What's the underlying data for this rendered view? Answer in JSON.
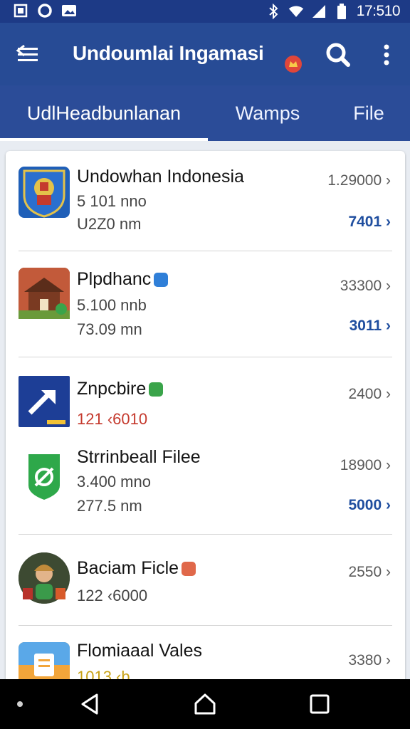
{
  "status_bar": {
    "time": "17:510",
    "left_icons": [
      "sim-icon",
      "circle-icon",
      "image-icon"
    ],
    "right_icons": [
      "bluetooth-icon",
      "wifi-icon",
      "signal-icon",
      "battery-icon"
    ]
  },
  "app_bar": {
    "title": "Undoumlai Ingamasi",
    "icons": [
      "menu-icon",
      "search-icon",
      "more-vert-icon"
    ]
  },
  "tabs": [
    {
      "label": "UdlHeadbunlanan",
      "selected": true
    },
    {
      "label": "Wamps",
      "selected": false
    },
    {
      "label": "File",
      "selected": false
    }
  ],
  "items": [
    {
      "title": "Undowhan Indonesia",
      "line2": "5 101 nno",
      "line3": "U2Z0 nm",
      "count": "1.29000",
      "count2": "7401",
      "icon": "emblem-icon"
    },
    {
      "title": "Plpdhanc",
      "line2": "5.100 nnb",
      "line3": "73.09 mn",
      "count": "33300",
      "count2": "3011",
      "icon": "house-icon"
    },
    {
      "title": "Znpcbire",
      "line2": "121 ‹6010",
      "line3": "",
      "count": "2400",
      "count2": "",
      "icon": "arrow-app-icon"
    },
    {
      "title": "Strrinbeall Filee",
      "line2": "3.400 mno",
      "line3": "277.5 nm",
      "count": "18900",
      "count2": "5000",
      "icon": "green-shield-icon"
    },
    {
      "title": "Baciam Ficle",
      "line2": "122 ‹6000",
      "line3": "",
      "count": "2550",
      "count2": "",
      "icon": "avatar-icon"
    },
    {
      "title": "Flomiaaal Vales",
      "line2": "1013 ‹b",
      "line3": "",
      "count": "3380",
      "count2": "",
      "icon": "folder-app-icon"
    }
  ],
  "colors": {
    "app_bar": "#274b95",
    "status_bar": "#1d3a86",
    "accent_blue": "#1f4e9f",
    "accent_red": "#c53a2e"
  },
  "nav_bar": {
    "icons": [
      "dot-icon",
      "back-icon",
      "home-icon",
      "recents-icon"
    ]
  }
}
